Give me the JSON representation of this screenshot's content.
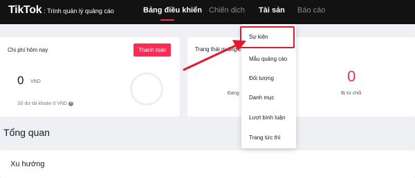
{
  "header": {
    "brand": "TikTok",
    "subtitle": ": Trình quản lý quảng cáo",
    "nav": [
      {
        "label": "Bảng điều khiển",
        "active": true
      },
      {
        "label": "Chiến dịch",
        "active": false
      },
      {
        "label": "Tài sản",
        "active": false
      },
      {
        "label": "Báo cáo",
        "active": false
      }
    ]
  },
  "cost_card": {
    "title": "Chi phí hôm nay",
    "pay_label": "Thanh toán",
    "value": "0",
    "unit": "VND",
    "balance": "Số dư tài khoản 0 VND",
    "help_glyph": "?"
  },
  "status_card": {
    "title": "Trạng thái quảng cáo",
    "pending_label": "Đang",
    "rejected_value": "0",
    "rejected_label": "Bị từ chối"
  },
  "overview": {
    "title": "Tổng quan",
    "trend_title": "Xu hướng"
  },
  "assets_menu": {
    "items": [
      "Sự kiện",
      "Mẫu quảng cáo",
      "Đối tượng",
      "Danh mục",
      "Lượt bình luận",
      "Trang tức thì"
    ]
  },
  "colors": {
    "accent": "#fe2c55",
    "annotation": "#e4162b",
    "topbar": "#121212"
  }
}
